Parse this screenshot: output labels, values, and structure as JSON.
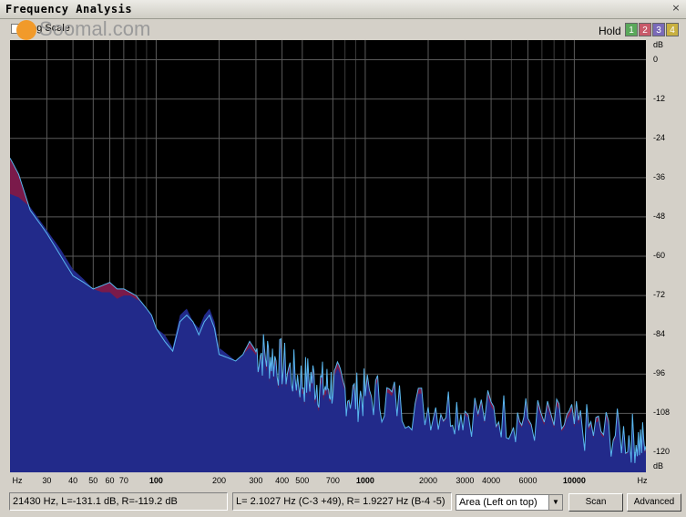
{
  "window": {
    "title": "Frequency Analysis",
    "close_glyph": "×"
  },
  "toolbar": {
    "checkbox_label": "Log Scale",
    "watermark": "Soomal.com",
    "hold_label": "Hold",
    "hold_buttons": [
      {
        "label": "1",
        "color": "#5aa85a"
      },
      {
        "label": "2",
        "color": "#c85a6a"
      },
      {
        "label": "3",
        "color": "#7a6ab8"
      },
      {
        "label": "4",
        "color": "#c8b040"
      }
    ]
  },
  "y_axis": {
    "unit_top": "dB",
    "unit_bottom": "dB",
    "ticks": [
      "0",
      "-12",
      "-24",
      "-36",
      "-48",
      "-60",
      "-72",
      "-84",
      "-96",
      "-108",
      "-120"
    ]
  },
  "x_axis": {
    "unit_left": "Hz",
    "unit_right": "Hz",
    "ticks": [
      {
        "hz": 30,
        "label": "30"
      },
      {
        "hz": 40,
        "label": "40"
      },
      {
        "hz": 50,
        "label": "50"
      },
      {
        "hz": 60,
        "label": "60"
      },
      {
        "hz": 70,
        "label": "70"
      },
      {
        "hz": 100,
        "label": "100",
        "bold": true
      },
      {
        "hz": 200,
        "label": "200"
      },
      {
        "hz": 300,
        "label": "300"
      },
      {
        "hz": 400,
        "label": "400"
      },
      {
        "hz": 500,
        "label": "500"
      },
      {
        "hz": 700,
        "label": "700"
      },
      {
        "hz": 1000,
        "label": "1000",
        "bold": true
      },
      {
        "hz": 2000,
        "label": "2000"
      },
      {
        "hz": 3000,
        "label": "3000"
      },
      {
        "hz": 4000,
        "label": "4000"
      },
      {
        "hz": 6000,
        "label": "6000"
      },
      {
        "hz": 10000,
        "label": "10000",
        "bold": true
      }
    ]
  },
  "status": {
    "cursor": "21430 Hz, L=-131.1 dB, R=-119.2 dB",
    "peaks": "L= 2.1027 Hz (C-3 +49), R= 1.9227 Hz (B-4 -5)",
    "view_mode": "Area (Left on top)",
    "scan_label": "Scan",
    "advanced_label": "Advanced"
  },
  "chart_data": {
    "type": "area",
    "x_scale": "log",
    "xlim": [
      20,
      22000
    ],
    "ylim": [
      -126,
      6
    ],
    "ylabel": "dB",
    "xlabel": "Hz",
    "grid": true,
    "colors": {
      "left": "#222a8a",
      "right_edge": "#5ab8f0",
      "right_fill": "#7a1a4a"
    },
    "series": [
      {
        "x": [
          20,
          22,
          25,
          30,
          35,
          40,
          45,
          50,
          55,
          60,
          65,
          70,
          75,
          80,
          85,
          90,
          95,
          100,
          110,
          120,
          130,
          140,
          150,
          160,
          170,
          180,
          190,
          200,
          220,
          240,
          260,
          280,
          300,
          330,
          360,
          400,
          450,
          500,
          550,
          600,
          650,
          700,
          800,
          900,
          1000,
          1200,
          1500,
          2000,
          2500,
          3000,
          4000,
          5000,
          6000,
          8000,
          10000,
          12000,
          15000,
          18000,
          20000,
          22000
        ],
        "y": [
          -41,
          -42,
          -45,
          -52,
          -58,
          -64,
          -67,
          -70,
          -71,
          -71,
          -73,
          -72,
          -72,
          -73,
          -74,
          -76,
          -78,
          -82,
          -84,
          -88,
          -78,
          -76,
          -80,
          -82,
          -78,
          -76,
          -80,
          -88,
          -90,
          -92,
          -90,
          -88,
          -90,
          -92,
          -93,
          -95,
          -97,
          -100,
          -99,
          -101,
          -102,
          -100,
          -102,
          -104,
          -103,
          -104,
          -106,
          -107,
          -107,
          -108,
          -109,
          -110,
          -111,
          -112,
          -113,
          -114,
          -115,
          -116,
          -117,
          -119
        ]
      },
      {
        "x": [
          20,
          22,
          25,
          30,
          35,
          40,
          45,
          50,
          55,
          60,
          65,
          70,
          75,
          80,
          85,
          90,
          95,
          100,
          110,
          120,
          130,
          140,
          150,
          160,
          170,
          180,
          190,
          200,
          220,
          240,
          260,
          280,
          300,
          330,
          360,
          400,
          450,
          500,
          550,
          600,
          650,
          700,
          800,
          900,
          1000,
          1200,
          1500,
          2000,
          2500,
          3000,
          4000,
          5000,
          6000,
          8000,
          10000,
          12000,
          15000,
          18000,
          20000,
          22000
        ],
        "y": [
          -30,
          -35,
          -46,
          -53,
          -60,
          -66,
          -68,
          -70,
          -69,
          -68,
          -70,
          -70,
          -71,
          -72,
          -74,
          -76,
          -78,
          -82,
          -86,
          -89,
          -80,
          -78,
          -80,
          -84,
          -80,
          -78,
          -82,
          -90,
          -91,
          -92,
          -90,
          -86,
          -89,
          -90,
          -91,
          -93,
          -96,
          -98,
          -97,
          -99,
          -100,
          -99,
          -101,
          -103,
          -102,
          -103,
          -105,
          -106,
          -106,
          -107,
          -108,
          -109,
          -110,
          -111,
          -112,
          -113,
          -114,
          -115,
          -116,
          -118
        ]
      }
    ]
  }
}
